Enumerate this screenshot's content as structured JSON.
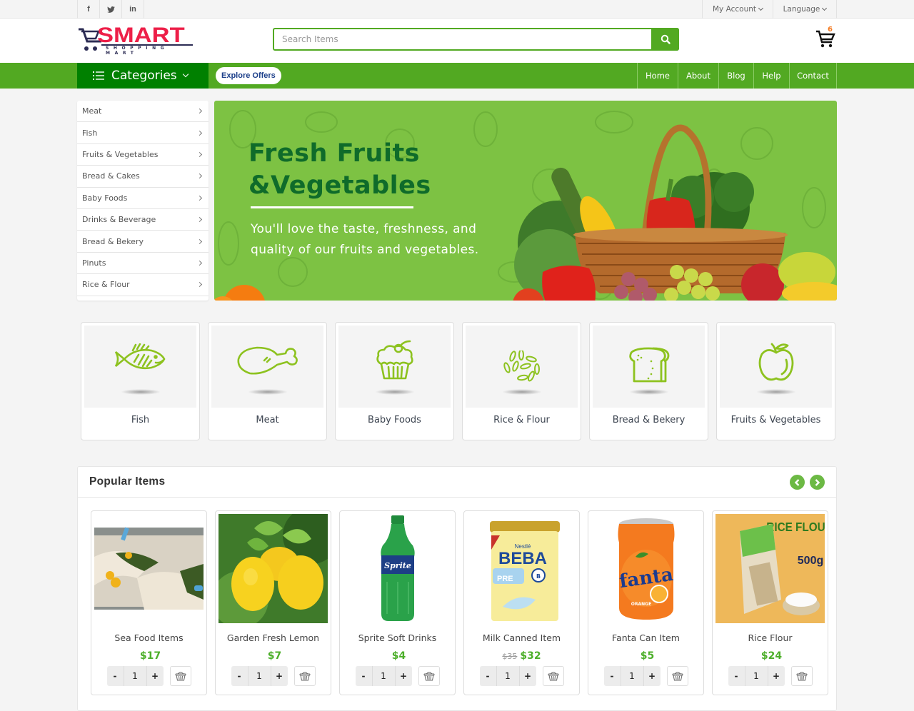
{
  "topbar": {
    "social": [
      {
        "icon": "facebook-icon",
        "glyph": "f"
      },
      {
        "icon": "twitter-icon",
        "glyph": "t"
      },
      {
        "icon": "linkedin-icon",
        "glyph": "in"
      }
    ],
    "my_account": "My Account",
    "language": "Language"
  },
  "header": {
    "logo_word": "SMART",
    "logo_sub": "SHOPPING MART",
    "search_placeholder": "Search Items",
    "cart_count": "6"
  },
  "navbar": {
    "categories_label": "Categories",
    "explore_offers": "Explore Offers",
    "links": [
      "Home",
      "About",
      "Blog",
      "Help",
      "Contact"
    ]
  },
  "sidebar": {
    "items": [
      "Meat",
      "Fish",
      "Fruits & Vegetables",
      "Bread & Cakes",
      "Baby Foods",
      "Drinks & Beverage",
      "Bread & Bekery",
      "Pinuts",
      "Rice & Flour"
    ]
  },
  "banner": {
    "title_line1": "Fresh Fruits",
    "title_line2": "&Vegetables",
    "text": "You'll love the taste, freshness, and quality of our fruits and vegetables."
  },
  "categories": [
    {
      "label": "Fish",
      "icon": "fish-icon"
    },
    {
      "label": "Meat",
      "icon": "meat-leg-icon"
    },
    {
      "label": "Baby Foods",
      "icon": "cupcake-icon"
    },
    {
      "label": "Rice & Flour",
      "icon": "rice-grains-icon"
    },
    {
      "label": "Bread & Bekery",
      "icon": "bread-icon"
    },
    {
      "label": "Fruits & Vegetables",
      "icon": "apple-icon"
    }
  ],
  "popular": {
    "title": "Popular Items",
    "products": [
      {
        "name": "Sea Food Items",
        "price": "$17",
        "old_price": "",
        "qty": "1",
        "image": "seafood-image"
      },
      {
        "name": "Garden Fresh Lemon",
        "price": "$7",
        "old_price": "",
        "qty": "1",
        "image": "lemon-image"
      },
      {
        "name": "Sprite Soft Drinks",
        "price": "$4",
        "old_price": "",
        "qty": "1",
        "image": "sprite-bottle-image"
      },
      {
        "name": "Milk Canned Item",
        "price": "$32",
        "old_price": "$35",
        "qty": "1",
        "image": "milk-can-image"
      },
      {
        "name": "Fanta Can Item",
        "price": "$5",
        "old_price": "",
        "qty": "1",
        "image": "fanta-can-image"
      },
      {
        "name": "Rice Flour",
        "price": "$24",
        "old_price": "",
        "qty": "1",
        "image": "rice-flour-image"
      }
    ],
    "minus_label": "-",
    "plus_label": "+"
  },
  "colors": {
    "brand_green": "#52a922",
    "dark_green": "#008000",
    "logo_red": "#ed1f48",
    "price_green": "#4caf2a",
    "icon_green": "#8dc21f"
  }
}
